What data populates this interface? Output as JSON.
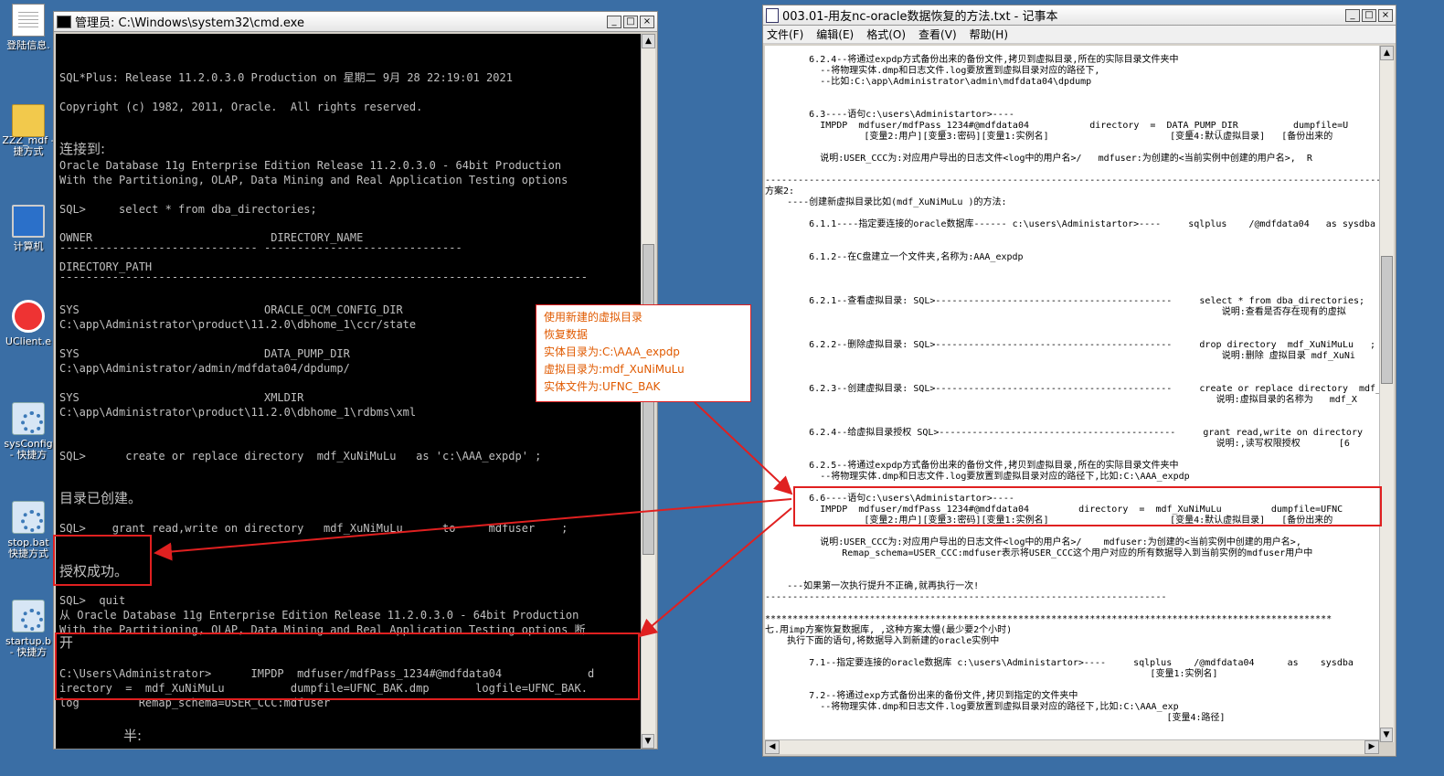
{
  "desktop": {
    "icons": [
      {
        "label": "登陆信息.",
        "icon": "document-icon"
      },
      {
        "label": "ZZZ_mdf -",
        "label2": "捷方式",
        "icon": "folder-icon"
      },
      {
        "label": "计算机",
        "icon": "computer-icon"
      },
      {
        "label": "UClient.e",
        "icon": "uclient-icon"
      },
      {
        "label": "sysConfig",
        "label2": "- 快捷方",
        "icon": "gear-shortcut-icon"
      },
      {
        "label": "stop.bat",
        "label2": "快捷方式",
        "icon": "gear-shortcut-icon"
      },
      {
        "label": "startup.b",
        "label2": "- 快捷方",
        "icon": "gear-shortcut-icon"
      }
    ]
  },
  "cmd": {
    "title": "管理员: C:\\Windows\\system32\\cmd.exe",
    "lines": [
      "SQL*Plus: Release 11.2.0.3.0 Production on 星期二 9月 28 22:19:01 2021",
      "Copyright (c) 1982, 2011, Oracle.  All rights reserved.",
      "连接到:",
      "Oracle Database 11g Enterprise Edition Release 11.2.0.3.0 - 64bit Production",
      "With the Partitioning, OLAP, Data Mining and Real Application Testing options",
      "SQL>     select * from dba_directories;",
      "OWNER                           DIRECTORY_NAME",
      "------------------------------ ------------------------------",
      "DIRECTORY_PATH",
      "--------------------------------------------------------------------------------",
      "SYS                            ORACLE_OCM_CONFIG_DIR",
      "C:\\app\\Administrator\\product\\11.2.0\\dbhome_1\\ccr/state",
      "SYS                            DATA_PUMP_DIR",
      "C:\\app\\Administrator/admin/mdfdata04/dpdump/",
      "SYS                            XMLDIR",
      "C:\\app\\Administrator\\product\\11.2.0\\dbhome_1\\rdbms\\xml",
      "SQL>      create or replace directory  mdf_XuNiMuLu   as 'c:\\AAA_expdp' ;",
      "目录已创建。",
      "SQL>    grant read,write on directory   mdf_XuNiMuLu      to     mdfuser    ;",
      "授权成功。",
      "SQL>  quit",
      "从 Oracle Database 11g Enterprise Edition Release 11.2.0.3.0 - 64bit Production",
      "With the Partitioning, OLAP, Data Mining and Real Application Testing options 断",
      "开",
      "C:\\Users\\Administrator>      IMPDP  mdfuser/mdfPass_1234#@mdfdata04             d",
      "irectory  =  mdf_XuNiMuLu          dumpfile=UFNC_BAK.dmp       logfile=UFNC_BAK.",
      "log         Remap_schema=USER_CCC:mdfuser",
      "半:"
    ]
  },
  "callout": {
    "lines": [
      "使用新建的虚拟目录",
      "恢复数据",
      "实体目录为:C:\\AAA_expdp",
      "虚拟目录为:mdf_XuNiMuLu",
      "实体文件为:UFNC_BAK"
    ]
  },
  "notepad": {
    "title": "003.01-用友nc-oracle数据恢复的方法.txt - 记事本",
    "menus": [
      "文件(F)",
      "编辑(E)",
      "格式(O)",
      "查看(V)",
      "帮助(H)"
    ],
    "lines": [
      "        6.2.4--将通过expdp方式备份出来的备份文件,拷贝到虚拟目录,所在的实际目录文件夹中",
      "          --将物理实体.dmp和日志文件.log要放置到虚拟目录对应的路径下,",
      "          --比如:C:\\app\\Administrator\\admin\\mdfdata04\\dpdump",
      "        6.3----语句c:\\users\\Administartor>----",
      "          IMPDP  mdfuser/mdfPass_1234#@mdfdata04           directory  =  DATA_PUMP_DIR          dumpfile=U",
      "                  [变量2:用户][变量3:密码][变量1:实例名]                      [变量4:默认虚拟目录]   [备份出来的",
      "          说明:USER_CCC为:对应用户导出的日志文件<log中的用户名>/   mdfuser:为创建的<当前实例中创建的用户名>,  R",
      "-----------------------------------------------------------------------------------------------------------------",
      "方案2:",
      "    ----创建新虚拟目录比如(mdf_XuNiMuLu )的方法:",
      "        6.1.1----指定要连接的oracle数据库------ c:\\users\\Administartor>----     sqlplus    /@mdfdata04   as sysdba",
      "        6.1.2--在C盘建立一个文件夹,名称为:AAA_expdp",
      "        6.2.1--查看虚拟目录: SQL>-------------------------------------------     select * from dba_directories;",
      "                                                                                   说明:查看是否存在现有的虚拟",
      "        6.2.2--删除虚拟目录: SQL>-------------------------------------------     drop directory  mdf_XuNiMuLu   ;",
      "                                                                                   说明:删除 虚拟目录 mdf_XuNi",
      "        6.2.3--创建虚拟目录: SQL>-------------------------------------------     create or replace directory  mdf_",
      "                                                                                  说明:虚拟目录的名称为   mdf_X",
      "        6.2.4--给虚拟目录授权 SQL>-------------------------------------------     grant read,write on directory   m",
      "                                                                                  说明:,读写权限授权       [6",
      "        6.2.5--将通过expdp方式备份出来的备份文件,拷贝到虚拟目录,所在的实际目录文件夹中",
      "          --将物理实体.dmp和日志文件.log要放置到虚拟目录对应的路径下,比如:C:\\AAA_expdp",
      "        6.6----语句c:\\users\\Administartor>----",
      "          IMPDP  mdfuser/mdfPass_1234#@mdfdata04         directory  =  mdf_XuNiMuLu         dumpfile=UFNC",
      "                  [变量2:用户][变量3:密码][变量1:实例名]                      [变量4:默认虚拟目录]   [备份出来的",
      "          说明:USER_CCC为:对应用户导出的日志文件<log中的用户名>/    mdfuser:为创建的<当前实例中创建的用户名>,",
      "              Remap_schema=USER_CCC:mdfuser表示将USER_CCC这个用户对应的所有数据导入到当前实例的mdfuser用户中",
      "    ---如果第一次执行提升不正确,就再执行一次!",
      "-------------------------------------------------------------------------",
      "*******************************************************************************************************",
      "七.用imp方案恢复数据库, ,这种方案太慢(最少要2个小时)",
      "    执行下面的语句,将数据导入到新建的oracle实例中",
      "        7.1--指定要连接的oracle数据库 c:\\users\\Administartor>----     sqlplus    /@mdfdata04      as    sysdba",
      "                                                                      [变量1:实例名]",
      "        7.2--将通过exp方式备份出来的备份文件,拷贝到指定的文件夹中",
      "          --将物理实体.dmp和日志文件.log要放置到虚拟目录对应的路径下,比如:C:\\AAA_exp",
      "                                                                         [变量4:路径]"
    ]
  }
}
